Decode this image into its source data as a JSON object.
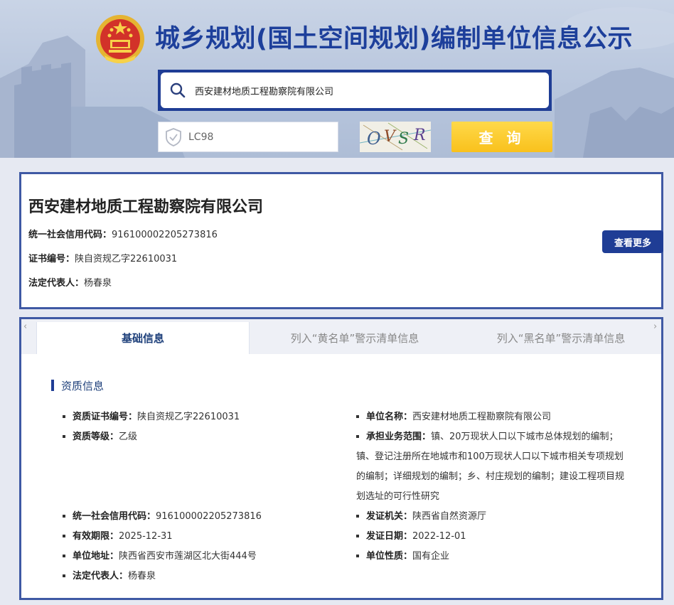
{
  "header": {
    "title": "城乡规划(国土空间规划)编制单位信息公示",
    "search_value": "西安建材地质工程勘察院有限公司",
    "captcha_value": "LC98",
    "captcha_image_text": "OVSR",
    "query_button": "查 询"
  },
  "company": {
    "name": "西安建材地质工程勘察院有限公司",
    "credit_code_label": "统一社会信用代码：",
    "credit_code": "916100002205273816",
    "cert_label": "证书编号：",
    "cert_no": "陕自资规乙字22610031",
    "legal_label": "法定代表人：",
    "legal_rep": "杨春泉",
    "more_button": "查看更多"
  },
  "tabs": {
    "left_arrow": "‹",
    "right_arrow": "›",
    "items": [
      "基础信息",
      "列入“黄名单”警示清单信息",
      "列入“黑名单”警示清单信息"
    ]
  },
  "qualification": {
    "section_title": "资质信息",
    "cert_no_label": "资质证书编号：",
    "cert_no": "陕自资规乙字22610031",
    "grade_label": "资质等级：",
    "grade": "乙级",
    "credit_code_label": "统一社会信用代码：",
    "credit_code": "916100002205273816",
    "valid_label": "有效期限：",
    "valid_until": "2025-12-31",
    "address_label": "单位地址：",
    "address": "陕西省西安市莲湖区北大街444号",
    "legal_label": "法定代表人：",
    "legal_rep": "杨春泉",
    "unit_name_label": "单位名称：",
    "unit_name": "西安建材地质工程勘察院有限公司",
    "scope_label": "承担业务范围：",
    "scope_line1": "镇、20万现状人口以下城市总体规划的编制；",
    "scope_line2": "镇、登记注册所在地城市和100万现状人口以下城市相关专项规划",
    "scope_line3": "的编制；详细规划的编制；乡、村庄规划的编制；建设工程项目规",
    "scope_line4": "划选址的可行性研究",
    "issuer_label": "发证机关：",
    "issuer": "陕西省自然资源厅",
    "issue_date_label": "发证日期：",
    "issue_date": "2022-12-01",
    "nature_label": "单位性质：",
    "nature": "国有企业"
  }
}
